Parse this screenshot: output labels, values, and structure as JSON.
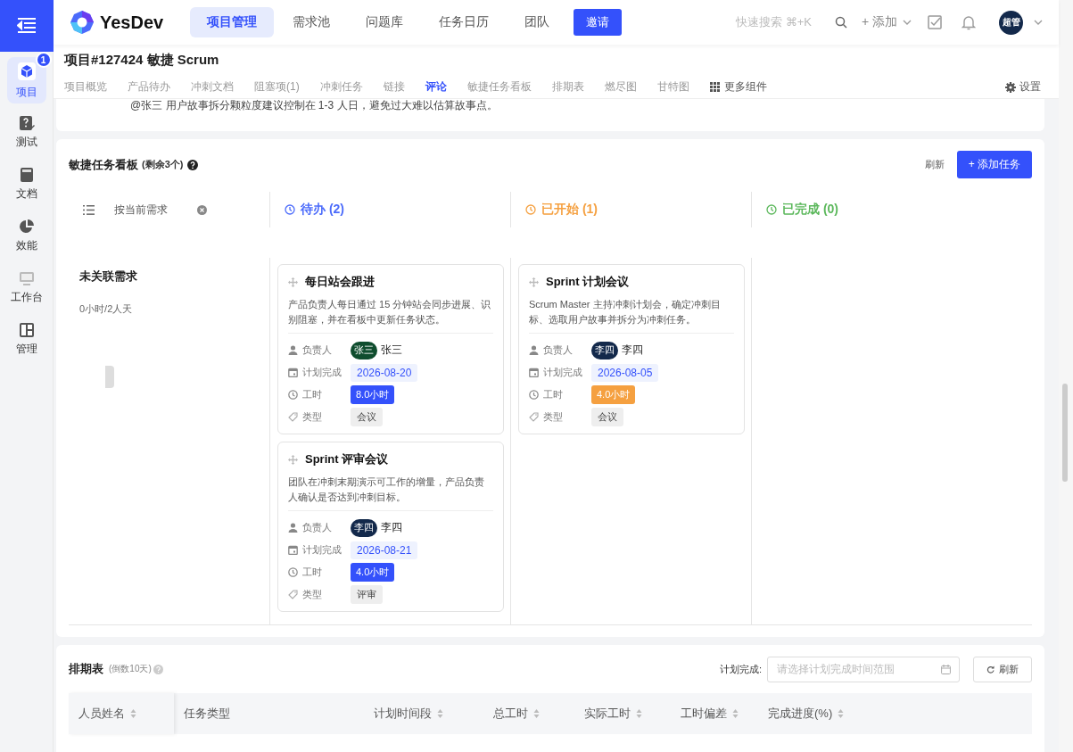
{
  "sidebar": {
    "items": [
      {
        "label": "项目",
        "selected": true,
        "badge": "1"
      },
      {
        "label": "测试",
        "selected": false
      },
      {
        "label": "文档",
        "selected": false
      },
      {
        "label": "效能",
        "selected": false
      },
      {
        "label": "工作台",
        "selected": false
      },
      {
        "label": "管理",
        "selected": false
      }
    ]
  },
  "topnav": {
    "logo": "YesDev",
    "tabs": [
      {
        "label": "项目管理",
        "selected": true
      },
      {
        "label": "需求池",
        "selected": false
      },
      {
        "label": "问题库",
        "selected": false
      },
      {
        "label": "任务日历",
        "selected": false
      },
      {
        "label": "团队",
        "selected": false
      }
    ],
    "invite": "邀请",
    "search_hint": "快速搜索 ⌘+K",
    "add": "+ 添加",
    "avatar": "超管"
  },
  "project": {
    "title": "项目#127424 敏捷 Scrum",
    "tabs": [
      {
        "label": "项目概览",
        "selected": false
      },
      {
        "label": "产品待办",
        "selected": false
      },
      {
        "label": "冲刺文档",
        "selected": false
      },
      {
        "label": "阻塞项(1)",
        "selected": false
      },
      {
        "label": "冲刺任务",
        "selected": false
      },
      {
        "label": "链接",
        "selected": false
      },
      {
        "label": "评论",
        "selected": true
      },
      {
        "label": "敏捷任务看板",
        "selected": false
      },
      {
        "label": "排期表",
        "selected": false
      },
      {
        "label": "燃尽图",
        "selected": false
      },
      {
        "label": "甘特图",
        "selected": false
      }
    ],
    "more": "更多组件",
    "settings": "设置"
  },
  "comment": "@张三 用户故事拆分颗粒度建议控制在 1-3 人日，避免过大难以估算故事点。",
  "kanban": {
    "title": "敏捷任务看板",
    "remaining": "(剩余3个)",
    "refresh": "刷新",
    "add": "+ 添加任务",
    "filter": "按当前需求",
    "group": {
      "title": "未关联需求",
      "summary": "0小时/2人天"
    },
    "columns": [
      {
        "label": "待办 (2)",
        "color": "#4b6bfb",
        "cards": [
          {
            "title": "每日站会跟进",
            "desc": "产品负责人每日通过 15 分钟站会同步进展、识别阻塞，并在看板中更新任务状态。",
            "fields": [
              {
                "kind": "person",
                "label": "负责人",
                "value": "张三",
                "avatar": "张三",
                "color": "#0f4d2e"
              },
              {
                "kind": "date",
                "label": "计划完成",
                "value": "2026-08-20"
              },
              {
                "kind": "hours",
                "label": "工时",
                "value": "8.0小时",
                "color": "#3451fb"
              },
              {
                "kind": "type",
                "label": "类型",
                "value": "会议"
              }
            ]
          },
          {
            "title": "Sprint 评审会议",
            "desc": "团队在冲刺末期演示可工作的增量，产品负责人确认是否达到冲刺目标。",
            "fields": [
              {
                "kind": "person",
                "label": "负责人",
                "value": "李四",
                "avatar": "李四",
                "color": "#13294b"
              },
              {
                "kind": "date",
                "label": "计划完成",
                "value": "2026-08-21"
              },
              {
                "kind": "hours",
                "label": "工时",
                "value": "4.0小时",
                "color": "#3451fb"
              },
              {
                "kind": "type",
                "label": "类型",
                "value": "评审"
              }
            ]
          }
        ]
      },
      {
        "label": "已开始 (1)",
        "color": "#f5a040",
        "cards": [
          {
            "title": "Sprint 计划会议",
            "desc": "Scrum Master 主持冲刺计划会，确定冲刺目标、选取用户故事并拆分为冲刺任务。",
            "fields": [
              {
                "kind": "person",
                "label": "负责人",
                "value": "李四",
                "avatar": "李四",
                "color": "#13294b"
              },
              {
                "kind": "date",
                "label": "计划完成",
                "value": "2026-08-05"
              },
              {
                "kind": "hours",
                "label": "工时",
                "value": "4.0小时",
                "color": "#f5a040"
              },
              {
                "kind": "type",
                "label": "类型",
                "value": "会议"
              }
            ]
          }
        ]
      },
      {
        "label": "已完成 (0)",
        "color": "#5cb85c"
      }
    ]
  },
  "schedule": {
    "title": "排期表",
    "hint": "(倒数10天)",
    "filter_label": "计划完成:",
    "date_placeholder": "请选择计划完成时间范围",
    "refresh": "刷新",
    "columns": [
      {
        "label": "人员姓名",
        "sortable": true
      },
      {
        "label": "任务类型",
        "sortable": false
      },
      {
        "label": "计划时间段",
        "sortable": true
      },
      {
        "label": "总工时",
        "sortable": true
      },
      {
        "label": "实际工时",
        "sortable": true
      },
      {
        "label": "工时偏差",
        "sortable": true
      },
      {
        "label": "完成进度(%)",
        "sortable": true
      }
    ]
  }
}
